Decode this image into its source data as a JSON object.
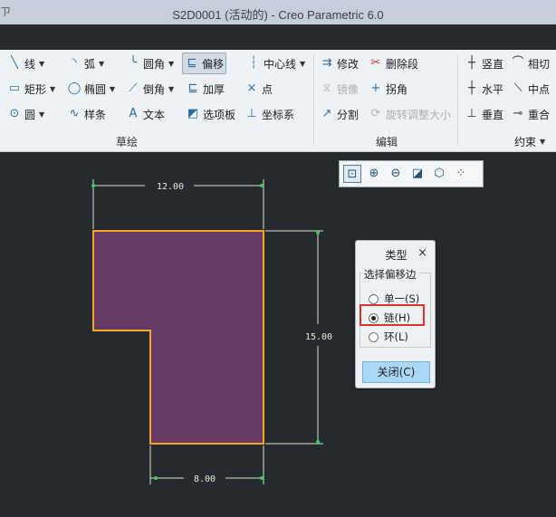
{
  "window": {
    "corner_glyph": "ㄗ",
    "title": "S2D0001 (活动的) - Creo Parametric 6.0"
  },
  "ribbon": {
    "sketch": {
      "label": "草绘",
      "line": "线",
      "arc": "弧",
      "fillet": "圆角",
      "offset": "偏移",
      "centerline": "中心线",
      "rectangle": "矩形",
      "ellipse": "椭圆",
      "chamfer": "倒角",
      "thicken": "加厚",
      "point": "点",
      "circle": "圆",
      "spline": "样条",
      "text": "文本",
      "palette": "选项板",
      "coord": "坐标系"
    },
    "edit": {
      "label": "编辑",
      "modify": "修改",
      "delete_segment": "删除段",
      "mirror": "镜像",
      "corner": "拐角",
      "divide": "分割",
      "rotate_resize": "旋转调整大小"
    },
    "constrain": {
      "label": "约束",
      "vertical": "竖直",
      "tangent": "相切",
      "horizontal": "水平",
      "midpoint": "中点",
      "perpendicular": "垂直",
      "coincident": "重合"
    }
  },
  "icons": {
    "line": "╲",
    "arc": "◝",
    "fillet": "╰",
    "offset": "⊑",
    "centerline": "┆",
    "rectangle": "▭",
    "ellipse": "◯",
    "chamfer": "⟋",
    "thicken": "⊑",
    "point": "×",
    "circle": "⊙",
    "spline": "∿",
    "text": "A",
    "palette": "◩",
    "coord": "⊥",
    "modify": "⇉",
    "delete": "✂",
    "mirror": "⧖",
    "corner": "+",
    "divide": "↗",
    "rotate": "⟳",
    "vertical": "┼",
    "tangent": "⌒",
    "horizontal": "┼",
    "midpoint": "⟍",
    "perpendicular": "⊥",
    "coincident": "⊸",
    "dropdown": "▼",
    "zoom_fit": "⊡",
    "zoom_in": "⊕",
    "zoom_out": "⊖",
    "repaint": "◪",
    "shading": "⬡",
    "display_filter": "⁘"
  },
  "sketch": {
    "dims": {
      "top_width": "12.00",
      "height": "15.00",
      "bottom_width": "8.00"
    },
    "colors": {
      "fill": "#633862",
      "edge": "#f5a623",
      "dimension": "#d8e2c8",
      "anchor": "#2dd35c"
    }
  },
  "dialog": {
    "title": "类型",
    "close_glyph": "×",
    "group_label": "选择偏移边",
    "options": [
      {
        "label": "单一(S)",
        "selected": false
      },
      {
        "label": "链(H)",
        "selected": true
      },
      {
        "label": "环(L)",
        "selected": false
      }
    ],
    "close_button": "关闭(C)"
  }
}
